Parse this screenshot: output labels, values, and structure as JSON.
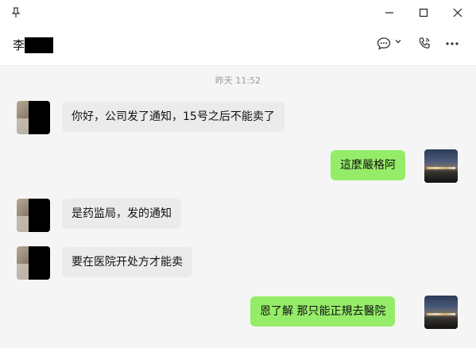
{
  "window": {
    "pin_icon": "pin-icon",
    "minimize_icon": "minimize-icon",
    "maximize_icon": "maximize-icon",
    "close_icon": "close-icon"
  },
  "header": {
    "contact_name_visible": "李",
    "chat_icon": "chat-bubble-icon",
    "call_icon": "phone-icon",
    "more_icon": "more-icon"
  },
  "messages": {
    "timestamp": "昨天 11:52",
    "items": [
      {
        "side": "left",
        "text": "你好，公司发了通知，15号之后不能卖了"
      },
      {
        "side": "right",
        "text": "這麼嚴格阿"
      },
      {
        "side": "left",
        "text": "是药监局，发的通知"
      },
      {
        "side": "left",
        "text": "要在医院开处方才能卖"
      },
      {
        "side": "right",
        "text": "恩了解 那只能正規去醫院"
      }
    ]
  },
  "colors": {
    "incoming_bubble": "#ebebeb",
    "outgoing_bubble": "#95ec69",
    "background": "#f5f5f5"
  }
}
